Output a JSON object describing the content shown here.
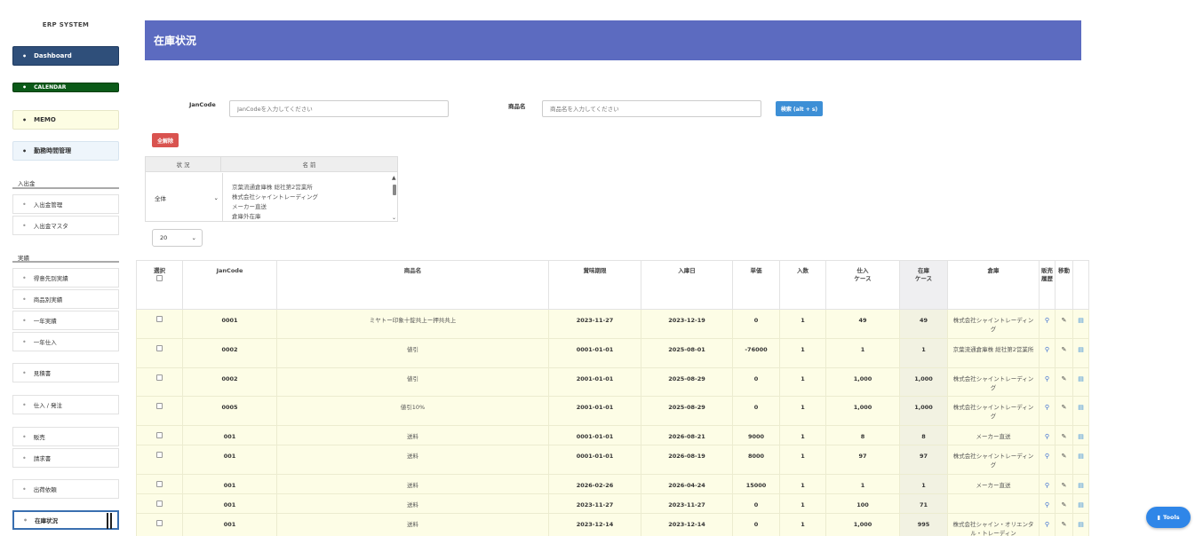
{
  "sidebar": {
    "system_title": "ERP SYSTEM",
    "dashboard": "Dashboard",
    "calendar": "CALENDAR",
    "memo": "MEMO",
    "notice": "勤務時間管理",
    "section_nyushukko": "入出金",
    "nyushukko_items": [
      "入出金管理",
      "入出金マスタ"
    ],
    "section_jisseki": "実績",
    "jisseki_items": [
      "得意先別実績",
      "商品別実績",
      "一年実績",
      "一年仕入"
    ],
    "mitsumori": "見積書",
    "purchase_items": [
      "仕入 / 発注"
    ],
    "sales_items": [
      "販売",
      "請求書"
    ],
    "shipping": "出荷依頼",
    "stock": "在庫状況"
  },
  "header": {
    "title": "在庫状況"
  },
  "search": {
    "jancode_label": "JanCode",
    "jancode_placeholder": "JanCodeを入力してください",
    "name_label": "商品名",
    "name_placeholder": "商品名を入力してください",
    "search_button": "検索 (alt + s)",
    "clear_button": "全解除"
  },
  "filter": {
    "condition_header": "状 況",
    "name_header": "名 前",
    "condition_value": "全体",
    "names": [
      "京葉流通倉庫株 総社第2営業所",
      "株式会社シャイントレーディング",
      "メーカー直送",
      "倉庫外在庫"
    ]
  },
  "per_page": "20",
  "table": {
    "headers": [
      "選択",
      "JanCode",
      "商品名",
      "賞味期限",
      "入庫日",
      "単価",
      "入数",
      "仕入\nケース",
      "在庫\nケース",
      "倉庫",
      "販売履歴",
      "移動",
      ""
    ],
    "rows": [
      {
        "jan": "0001",
        "name": "ミヤトー印象十錠共上ー押共共上",
        "expiry": "2023-11-27",
        "date": "2023-12-19",
        "price": "0",
        "qty": "1",
        "purchase": "49",
        "stock": "49",
        "warehouse": "株式会社シャイントレーディング"
      },
      {
        "jan": "0002",
        "name": "値引",
        "expiry": "0001-01-01",
        "date": "2025-08-01",
        "price": "-76000",
        "qty": "1",
        "purchase": "1",
        "stock": "1",
        "warehouse": "京葉流通倉庫株 総社第2営業所"
      },
      {
        "jan": "0002",
        "name": "値引",
        "expiry": "2001-01-01",
        "date": "2025-08-29",
        "price": "0",
        "qty": "1",
        "purchase": "1,000",
        "stock": "1,000",
        "warehouse": "株式会社シャイントレーディング"
      },
      {
        "jan": "0005",
        "name": "値引10%",
        "expiry": "2001-01-01",
        "date": "2025-08-29",
        "price": "0",
        "qty": "1",
        "purchase": "1,000",
        "stock": "1,000",
        "warehouse": "株式会社シャイントレーディング"
      },
      {
        "jan": "001",
        "name": "送料",
        "expiry": "0001-01-01",
        "date": "2026-08-21",
        "price": "9000",
        "qty": "1",
        "purchase": "8",
        "stock": "8",
        "warehouse": "メーカー直送"
      },
      {
        "jan": "001",
        "name": "送料",
        "expiry": "0001-01-01",
        "date": "2026-08-19",
        "price": "8000",
        "qty": "1",
        "purchase": "97",
        "stock": "97",
        "warehouse": "株式会社シャイントレーディング"
      },
      {
        "jan": "001",
        "name": "送料",
        "expiry": "2026-02-26",
        "date": "2026-04-24",
        "price": "15000",
        "qty": "1",
        "purchase": "1",
        "stock": "1",
        "warehouse": "メーカー直送"
      },
      {
        "jan": "001",
        "name": "送料",
        "expiry": "2023-11-27",
        "date": "2023-11-27",
        "price": "0",
        "qty": "1",
        "purchase": "100",
        "stock": "71",
        "warehouse": ""
      },
      {
        "jan": "001",
        "name": "送料",
        "expiry": "2023-12-14",
        "date": "2023-12-14",
        "price": "0",
        "qty": "1",
        "purchase": "1,000",
        "stock": "995",
        "warehouse": "株式会社シャイン・オリエンタル・トレーディン"
      }
    ]
  },
  "tools_button": "Tools",
  "colors": {
    "header": "#5c6bc0",
    "dashboard": "#2f4f7a",
    "calendar": "#0b5a18",
    "row_bg": "#fdfde6",
    "search_btn": "#3d8fd6",
    "clear_btn": "#d9534f"
  }
}
